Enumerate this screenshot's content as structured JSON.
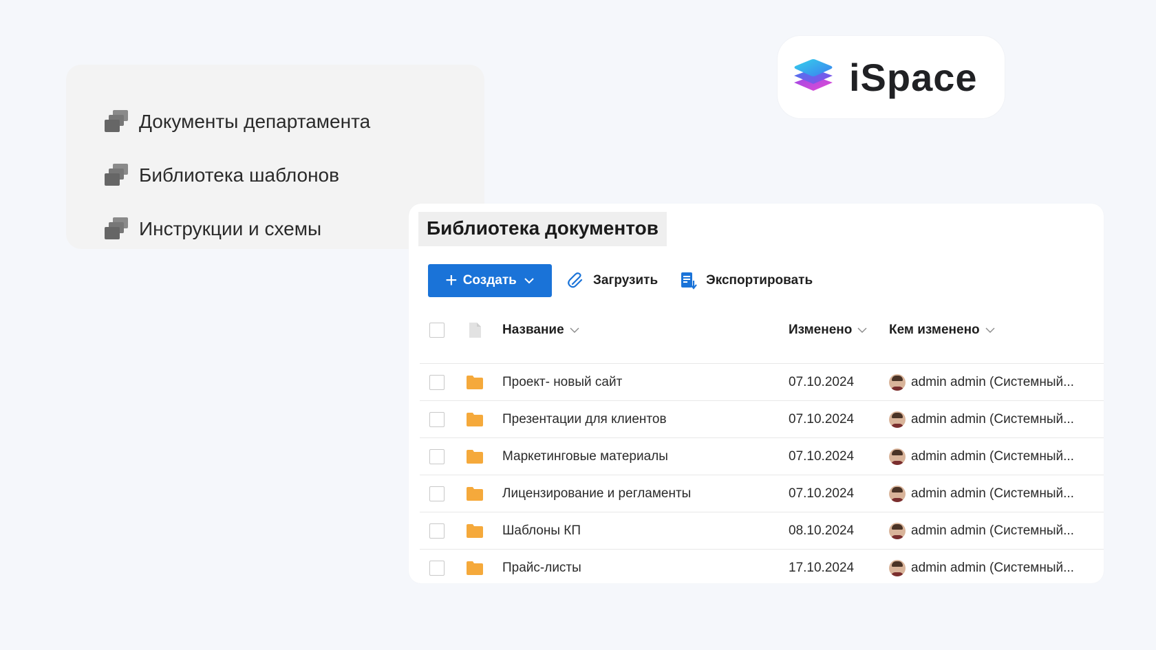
{
  "nav": {
    "items": [
      {
        "label": "Документы департамента",
        "icon": "folders-icon"
      },
      {
        "label": "Библиотека шаблонов",
        "icon": "folders-icon"
      },
      {
        "label": "Инструкции и схемы",
        "icon": "folders-icon"
      }
    ]
  },
  "logo": {
    "text": "iSpace",
    "colors": [
      "#2fc7e8",
      "#3f7df0",
      "#9b4ae6",
      "#e34bd4"
    ]
  },
  "library": {
    "title": "Библиотека документов",
    "toolbar": {
      "create_label": "Создать",
      "upload_label": "Загрузить",
      "export_label": "Экспортировать"
    },
    "columns": {
      "name": "Название",
      "modified": "Изменено",
      "modified_by": "Кем изменено"
    },
    "rows": [
      {
        "name": "Проект- новый сайт",
        "modified": "07.10.2024",
        "modified_by": "admin admin (Системный..."
      },
      {
        "name": "Презентации для клиентов",
        "modified": "07.10.2024",
        "modified_by": "admin admin (Системный..."
      },
      {
        "name": "Маркетинговые материалы",
        "modified": "07.10.2024",
        "modified_by": "admin admin (Системный..."
      },
      {
        "name": "Лицензирование и регламенты",
        "modified": "07.10.2024",
        "modified_by": "admin admin (Системный..."
      },
      {
        "name": "Шаблоны КП",
        "modified": "08.10.2024",
        "modified_by": "admin admin (Системный..."
      },
      {
        "name": "Прайс-листы",
        "modified": "17.10.2024",
        "modified_by": "admin admin (Системный..."
      }
    ]
  },
  "colors": {
    "accent": "#1a73d8",
    "folder": "#f5a93b",
    "background": "#f5f7fb"
  }
}
